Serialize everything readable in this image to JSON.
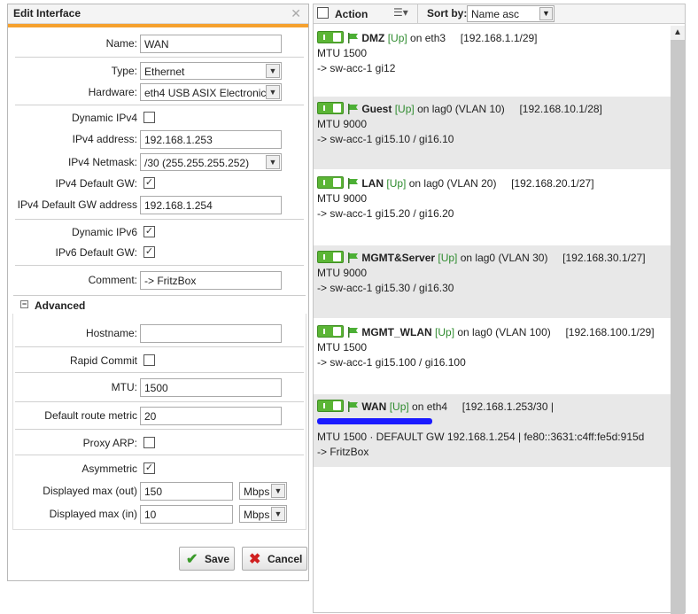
{
  "left_panel": {
    "title": "Edit Interface",
    "fields": {
      "name_label": "Name:",
      "name_value": "WAN",
      "type_label": "Type:",
      "type_value": "Ethernet",
      "hardware_label": "Hardware:",
      "hardware_value": "eth4 USB ASIX Electronic",
      "dyn_ipv4_label": "Dynamic IPv4",
      "ipv4_addr_label": "IPv4 address:",
      "ipv4_addr_value": "192.168.1.253",
      "ipv4_mask_label": "IPv4 Netmask:",
      "ipv4_mask_value": "/30 (255.255.255.252)",
      "ipv4_gw_label": "IPv4 Default GW:",
      "ipv4_gw_addr_label": "IPv4 Default GW address",
      "ipv4_gw_addr_value": "192.168.1.254",
      "dyn_ipv6_label": "Dynamic IPv6",
      "ipv6_gw_label": "IPv6 Default GW:",
      "comment_label": "Comment:",
      "comment_value": "-> FritzBox"
    },
    "checkboxes": {
      "dyn_ipv4": false,
      "ipv4_gw": true,
      "dyn_ipv6": true,
      "ipv6_gw": true,
      "rapid_commit": false,
      "proxy_arp": false,
      "asymmetric": true
    },
    "advanced": {
      "title": "Advanced",
      "hostname_label": "Hostname:",
      "hostname_value": "",
      "rapid_commit_label": "Rapid Commit",
      "mtu_label": "MTU:",
      "mtu_value": "1500",
      "metric_label": "Default route metric",
      "metric_value": "20",
      "proxy_arp_label": "Proxy ARP:",
      "asym_label": "Asymmetric",
      "max_out_label": "Displayed max (out)",
      "max_out_value": "150",
      "max_out_unit": "Mbps",
      "max_in_label": "Displayed max (in)",
      "max_in_value": "10",
      "max_in_unit": "Mbps"
    },
    "buttons": {
      "save": "Save",
      "cancel": "Cancel"
    }
  },
  "right_panel": {
    "action_label": "Action",
    "sort_label": "Sort by:",
    "sort_value": "Name asc",
    "interfaces": [
      {
        "name": "DMZ",
        "status": "[Up]",
        "on": "on eth3",
        "net": "[192.168.1.1/29]",
        "line2": "MTU 1500",
        "line3": "-> sw-acc-1 gi12"
      },
      {
        "name": "Guest",
        "status": "[Up]",
        "on": "on lag0 (VLAN 10)",
        "net": "[192.168.10.1/28]",
        "line2": "MTU 9000",
        "line3": "-> sw-acc-1 gi15.10 / gi16.10"
      },
      {
        "name": "LAN",
        "status": "[Up]",
        "on": "on lag0 (VLAN 20)",
        "net": "[192.168.20.1/27]",
        "line2": "MTU 9000",
        "line3": "-> sw-acc-1 gi15.20 / gi16.20"
      },
      {
        "name": "MGMT&Server",
        "status": "[Up]",
        "on": "on lag0 (VLAN 30)",
        "net": "[192.168.30.1/27]",
        "line2": "MTU 9000",
        "line3": "-> sw-acc-1 gi15.30 / gi16.30"
      },
      {
        "name": "MGMT_WLAN",
        "status": "[Up]",
        "on": "on lag0 (VLAN 100)",
        "net": "[192.168.100.1/29]",
        "line2": "MTU 1500",
        "line3": "-> sw-acc-1 gi15.100 / gi16.100"
      },
      {
        "name": "WAN",
        "status": "[Up]",
        "on": "on eth4",
        "net": "[192.168.1.253/30 |",
        "line2": "MTU 1500 · DEFAULT GW 192.168.1.254 | fe80::3631:c4ff:fe5d:915d",
        "line3": "-> FritzBox"
      }
    ]
  },
  "colors": {
    "accent": "#f5a12e",
    "up_green": "#2e8b2e",
    "toggle_green": "#5bb535",
    "redaction": "#1a1aff"
  }
}
